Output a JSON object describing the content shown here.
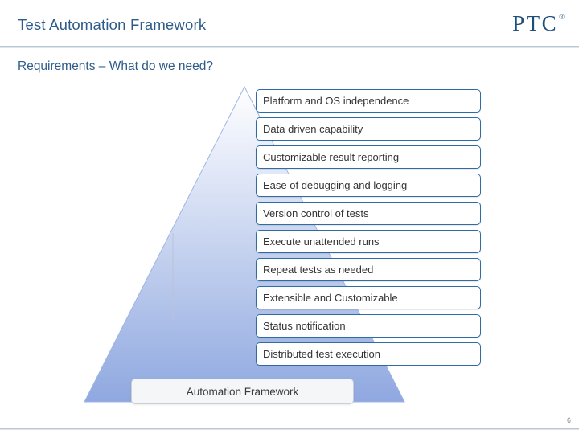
{
  "slide": {
    "title": "Test Automation Framework",
    "subtitle": "Requirements – What do we need?",
    "page_number": "6",
    "logo": {
      "word": "PTC",
      "registered": "®"
    },
    "pyramid": {
      "fill_top_color": "#ffffff",
      "fill_bottom_color": "#8fa8e0",
      "base_label": "Automation Framework",
      "items": [
        {
          "label": "Platform and OS independence"
        },
        {
          "label": "Data driven capability"
        },
        {
          "label": "Customizable result reporting"
        },
        {
          "label": "Ease of debugging and logging"
        },
        {
          "label": "Version control of tests"
        },
        {
          "label": "Execute unattended runs"
        },
        {
          "label": "Repeat tests as needed"
        },
        {
          "label": "Extensible and Customizable"
        },
        {
          "label": "Status notification"
        },
        {
          "label": "Distributed test execution"
        }
      ]
    }
  }
}
